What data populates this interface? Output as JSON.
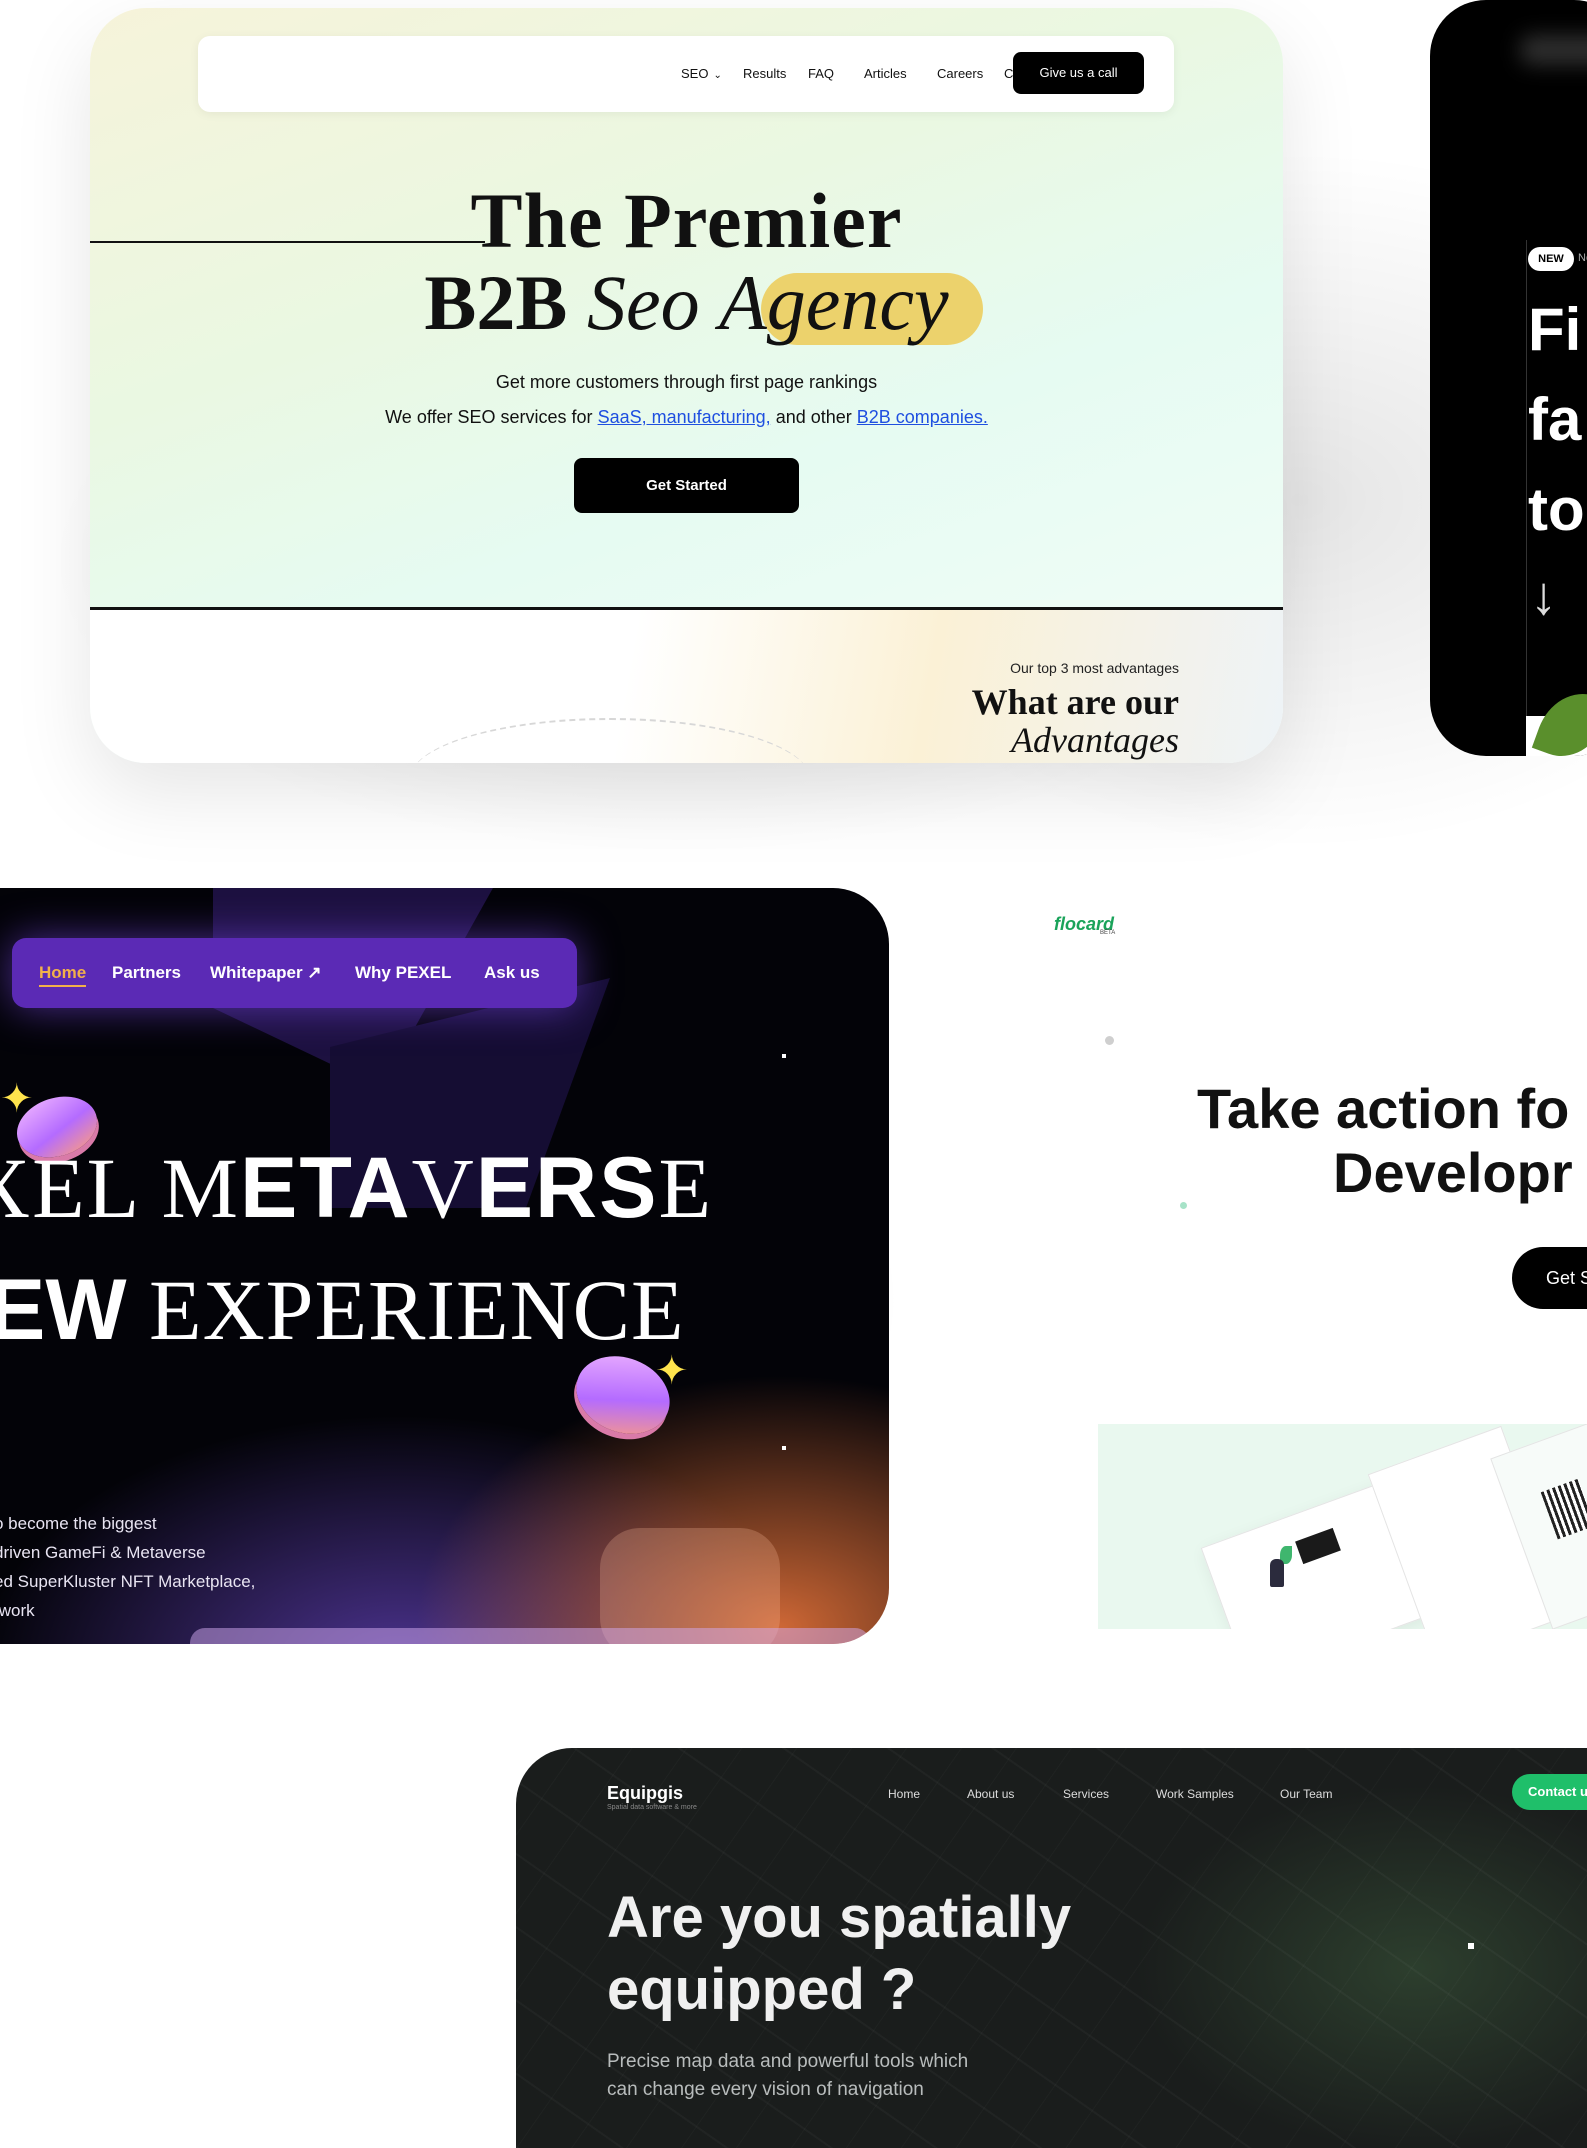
{
  "seo_card": {
    "nav": {
      "items": [
        "SEO",
        "Results",
        "FAQ",
        "Articles",
        "Careers",
        "Contact"
      ],
      "cta": "Give us a call"
    },
    "hero": {
      "title_line1": "The Premier",
      "title_b2b": "B2B",
      "title_seo": "Seo",
      "title_agency": "Agency",
      "subtitle": "Get more customers through first page rankings",
      "offer_prefix": "We offer SEO services for",
      "offer_link1": "SaaS, manufacturing,",
      "offer_mid": "and other",
      "offer_link2": "B2B companies.",
      "cta": "Get Started"
    },
    "advantages": {
      "eyebrow": "Our top 3 most advantages",
      "heading": "What are our",
      "heading_italic": "Advantages"
    },
    "colors": {
      "highlight": "#ecd26c",
      "link": "#1f4fe0"
    }
  },
  "dark_card_right": {
    "badge": "NEW",
    "badge_text": "Ne",
    "lines": [
      "Fi",
      "fa",
      "to"
    ],
    "arrow": "↓"
  },
  "pexel_card": {
    "nav": [
      "Home",
      "Partners",
      "Whitepaper ↗",
      "Why PEXEL",
      "Ask us"
    ],
    "headline1_light": "XEL ",
    "headline1_m": "M",
    "headline1_bold": "ETA",
    "headline1_v": "V",
    "headline1_rest": "ERS",
    "headline1_e": "E",
    "headline2_bold": "EW",
    "headline2_light": " EXPERIENCE",
    "body_lines": [
      "o become the biggest",
      "driven GameFi & Metaverse",
      "ed SuperKluster NFT Marketplace,",
      "twork"
    ],
    "colors": {
      "nav_bg": "#5b2ab5",
      "active": "#f2b04a"
    }
  },
  "flocard_card": {
    "logo": "flocard",
    "logo_sub": "BETA",
    "headline1": "Take action fo",
    "headline2": "Developr",
    "cta": "Get S"
  },
  "equipgis_card": {
    "logo": "Equipgis",
    "logo_sub": "Spatial data software & more",
    "nav": [
      "Home",
      "About us",
      "Services",
      "Work Samples",
      "Our Team"
    ],
    "cta": "Contact u",
    "headline1": "Are you spatially",
    "headline2": "equipped ?",
    "para1": "Precise map data and powerful tools which",
    "para2": "can change every vision of navigation",
    "colors": {
      "cta": "#1fbf6a"
    }
  }
}
